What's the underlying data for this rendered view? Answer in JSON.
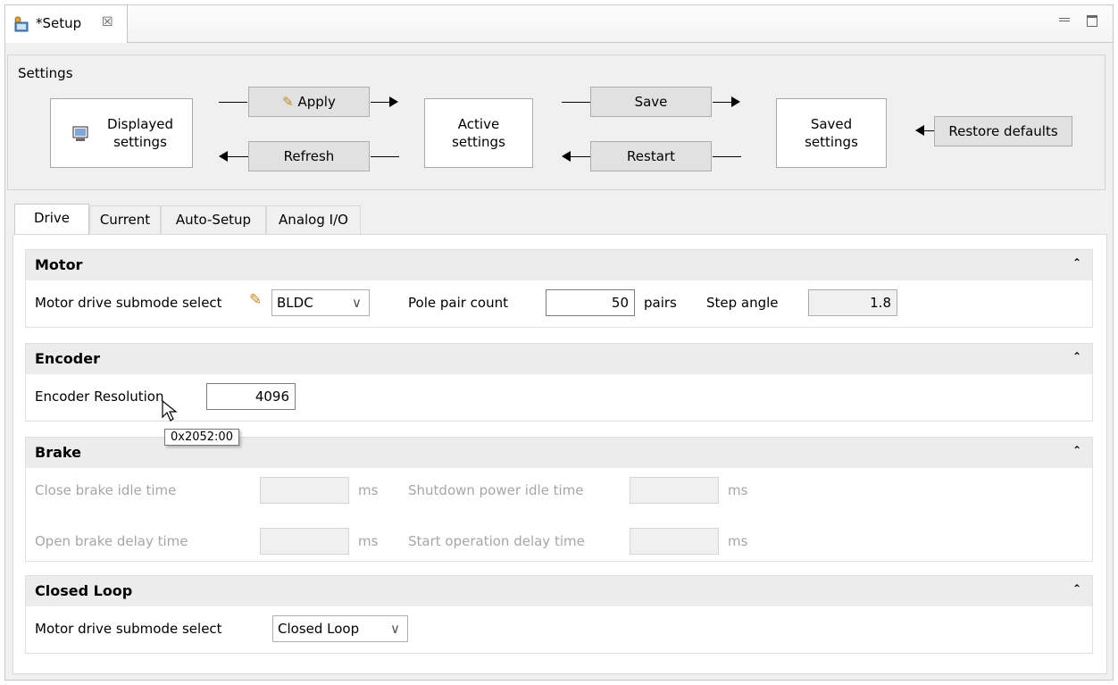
{
  "editor": {
    "tab_title": "*Setup",
    "close_glyph": "☒"
  },
  "settings": {
    "title": "Settings",
    "displayed_settings": "Displayed settings",
    "apply": "Apply",
    "refresh": "Refresh",
    "active_settings": "Active settings",
    "save": "Save",
    "restart": "Restart",
    "saved_settings": "Saved settings",
    "restore_defaults": "Restore defaults"
  },
  "tabs": [
    "Drive",
    "Current",
    "Auto-Setup",
    "Analog I/O"
  ],
  "motor": {
    "title": "Motor",
    "submode_label": "Motor drive submode select",
    "submode_value": "BLDC",
    "pole_pair_label": "Pole pair count",
    "pole_pair_value": "50",
    "pole_pair_unit": "pairs",
    "step_angle_label": "Step angle",
    "step_angle_value": "1.8"
  },
  "encoder": {
    "title": "Encoder",
    "resolution_label": "Encoder Resolution",
    "resolution_value": "4096"
  },
  "tooltip": {
    "text": "0x2052:00"
  },
  "brake": {
    "title": "Brake",
    "close_idle_label": "Close brake idle time",
    "close_idle_unit": "ms",
    "shutdown_idle_label": "Shutdown power idle time",
    "shutdown_idle_unit": "ms",
    "open_delay_label": "Open brake delay time",
    "open_delay_unit": "ms",
    "start_delay_label": "Start operation delay time",
    "start_delay_unit": "ms"
  },
  "closed_loop": {
    "title": "Closed Loop",
    "submode_label": "Motor drive submode select",
    "submode_value": "Closed Loop"
  },
  "icons": {
    "collapse": "⌃",
    "dropdown": "∨"
  }
}
